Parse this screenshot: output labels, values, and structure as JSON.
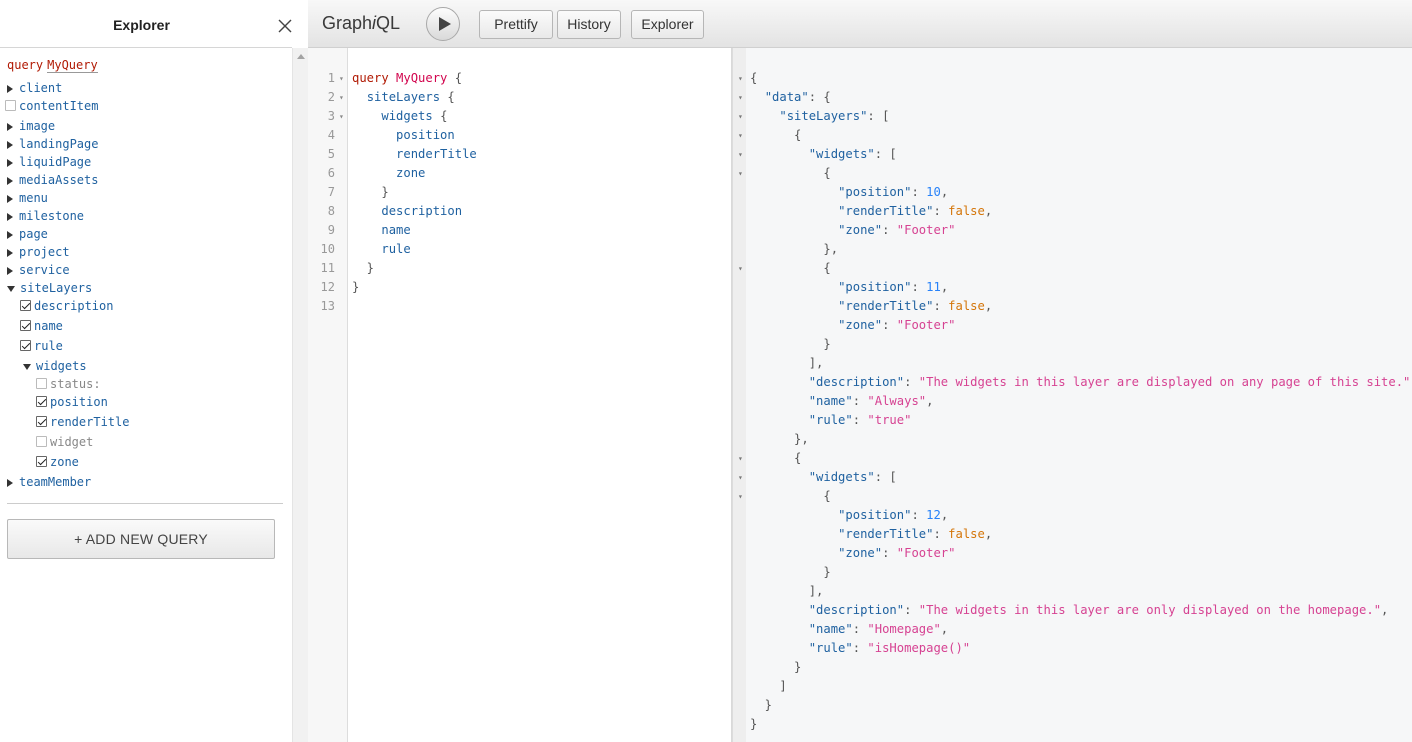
{
  "explorer": {
    "title": "Explorer",
    "query_keyword": "query",
    "query_name": "MyQuery",
    "fields": [
      {
        "name": "client",
        "state": "collapsed"
      },
      {
        "name": "contentItem",
        "state": "unchecked"
      },
      {
        "name": "image",
        "state": "collapsed"
      },
      {
        "name": "landingPage",
        "state": "collapsed"
      },
      {
        "name": "liquidPage",
        "state": "collapsed"
      },
      {
        "name": "mediaAssets",
        "state": "collapsed"
      },
      {
        "name": "menu",
        "state": "collapsed"
      },
      {
        "name": "milestone",
        "state": "collapsed"
      },
      {
        "name": "page",
        "state": "collapsed"
      },
      {
        "name": "project",
        "state": "collapsed"
      },
      {
        "name": "service",
        "state": "collapsed"
      },
      {
        "name": "siteLayers",
        "state": "expanded"
      },
      {
        "name": "teamMember",
        "state": "collapsed"
      }
    ],
    "siteLayers_children": [
      {
        "name": "description",
        "checked": true
      },
      {
        "name": "name",
        "checked": true
      },
      {
        "name": "rule",
        "checked": true
      },
      {
        "name": "widgets",
        "expanded": true
      }
    ],
    "widgets_children": [
      {
        "name": "status:",
        "checked": false
      },
      {
        "name": "position",
        "checked": true
      },
      {
        "name": "renderTitle",
        "checked": true
      },
      {
        "name": "widget",
        "checked": false
      },
      {
        "name": "zone",
        "checked": true
      }
    ],
    "add_query_label": "+ ADD NEW QUERY",
    "close_icon": "close-icon"
  },
  "toolbar": {
    "logo_prefix": "Graph",
    "logo_i": "i",
    "logo_suffix": "QL",
    "run_icon": "play-icon",
    "prettify_label": "Prettify",
    "history_label": "History",
    "explorer_label": "Explorer"
  },
  "editor": {
    "lines": [
      {
        "num": "1",
        "fold": true,
        "tokens": [
          [
            "kw",
            "query"
          ],
          [
            "pn",
            " "
          ],
          [
            "def",
            "MyQuery"
          ],
          [
            "pn",
            " {"
          ]
        ]
      },
      {
        "num": "2",
        "fold": true,
        "tokens": [
          [
            "pn",
            "  "
          ],
          [
            "prop",
            "siteLayers"
          ],
          [
            "pn",
            " {"
          ]
        ]
      },
      {
        "num": "3",
        "fold": true,
        "tokens": [
          [
            "pn",
            "    "
          ],
          [
            "prop",
            "widgets"
          ],
          [
            "pn",
            " {"
          ]
        ]
      },
      {
        "num": "4",
        "fold": false,
        "tokens": [
          [
            "pn",
            "      "
          ],
          [
            "prop",
            "position"
          ]
        ]
      },
      {
        "num": "5",
        "fold": false,
        "tokens": [
          [
            "pn",
            "      "
          ],
          [
            "prop",
            "renderTitle"
          ]
        ]
      },
      {
        "num": "6",
        "fold": false,
        "tokens": [
          [
            "pn",
            "      "
          ],
          [
            "prop",
            "zone"
          ]
        ]
      },
      {
        "num": "7",
        "fold": false,
        "tokens": [
          [
            "pn",
            "    }"
          ]
        ]
      },
      {
        "num": "8",
        "fold": false,
        "tokens": [
          [
            "pn",
            "    "
          ],
          [
            "prop",
            "description"
          ]
        ]
      },
      {
        "num": "9",
        "fold": false,
        "tokens": [
          [
            "pn",
            "    "
          ],
          [
            "prop",
            "name"
          ]
        ]
      },
      {
        "num": "10",
        "fold": false,
        "tokens": [
          [
            "pn",
            "    "
          ],
          [
            "prop",
            "rule"
          ]
        ]
      },
      {
        "num": "11",
        "fold": false,
        "tokens": [
          [
            "pn",
            "  }"
          ]
        ]
      },
      {
        "num": "12",
        "fold": false,
        "tokens": [
          [
            "pn",
            "}"
          ]
        ]
      },
      {
        "num": "13",
        "fold": false,
        "tokens": []
      }
    ]
  },
  "result": {
    "lines": [
      {
        "fold": true,
        "tokens": [
          [
            "pn",
            "{"
          ]
        ]
      },
      {
        "fold": true,
        "tokens": [
          [
            "pn",
            "  "
          ],
          [
            "rkey",
            "\"data\""
          ],
          [
            "pn",
            ": {"
          ]
        ]
      },
      {
        "fold": true,
        "tokens": [
          [
            "pn",
            "    "
          ],
          [
            "rkey",
            "\"siteLayers\""
          ],
          [
            "pn",
            ": ["
          ]
        ]
      },
      {
        "fold": true,
        "tokens": [
          [
            "pn",
            "      {"
          ]
        ]
      },
      {
        "fold": true,
        "tokens": [
          [
            "pn",
            "        "
          ],
          [
            "rkey",
            "\"widgets\""
          ],
          [
            "pn",
            ": ["
          ]
        ]
      },
      {
        "fold": true,
        "tokens": [
          [
            "pn",
            "          {"
          ]
        ]
      },
      {
        "fold": false,
        "tokens": [
          [
            "pn",
            "            "
          ],
          [
            "rkey",
            "\"position\""
          ],
          [
            "pn",
            ": "
          ],
          [
            "rnum",
            "10"
          ],
          [
            "pn",
            ","
          ]
        ]
      },
      {
        "fold": false,
        "tokens": [
          [
            "pn",
            "            "
          ],
          [
            "rkey",
            "\"renderTitle\""
          ],
          [
            "pn",
            ": "
          ],
          [
            "rbool",
            "false"
          ],
          [
            "pn",
            ","
          ]
        ]
      },
      {
        "fold": false,
        "tokens": [
          [
            "pn",
            "            "
          ],
          [
            "rkey",
            "\"zone\""
          ],
          [
            "pn",
            ": "
          ],
          [
            "rstr",
            "\"Footer\""
          ]
        ]
      },
      {
        "fold": false,
        "tokens": [
          [
            "pn",
            "          },"
          ]
        ]
      },
      {
        "fold": true,
        "tokens": [
          [
            "pn",
            "          {"
          ]
        ]
      },
      {
        "fold": false,
        "tokens": [
          [
            "pn",
            "            "
          ],
          [
            "rkey",
            "\"position\""
          ],
          [
            "pn",
            ": "
          ],
          [
            "rnum",
            "11"
          ],
          [
            "pn",
            ","
          ]
        ]
      },
      {
        "fold": false,
        "tokens": [
          [
            "pn",
            "            "
          ],
          [
            "rkey",
            "\"renderTitle\""
          ],
          [
            "pn",
            ": "
          ],
          [
            "rbool",
            "false"
          ],
          [
            "pn",
            ","
          ]
        ]
      },
      {
        "fold": false,
        "tokens": [
          [
            "pn",
            "            "
          ],
          [
            "rkey",
            "\"zone\""
          ],
          [
            "pn",
            ": "
          ],
          [
            "rstr",
            "\"Footer\""
          ]
        ]
      },
      {
        "fold": false,
        "tokens": [
          [
            "pn",
            "          }"
          ]
        ]
      },
      {
        "fold": false,
        "tokens": [
          [
            "pn",
            "        ],"
          ]
        ]
      },
      {
        "fold": false,
        "tokens": [
          [
            "pn",
            "        "
          ],
          [
            "rkey",
            "\"description\""
          ],
          [
            "pn",
            ": "
          ],
          [
            "rstr",
            "\"The widgets in this layer are displayed on any page of this site.\""
          ],
          [
            "pn",
            ","
          ]
        ]
      },
      {
        "fold": false,
        "tokens": [
          [
            "pn",
            "        "
          ],
          [
            "rkey",
            "\"name\""
          ],
          [
            "pn",
            ": "
          ],
          [
            "rstr",
            "\"Always\""
          ],
          [
            "pn",
            ","
          ]
        ]
      },
      {
        "fold": false,
        "tokens": [
          [
            "pn",
            "        "
          ],
          [
            "rkey",
            "\"rule\""
          ],
          [
            "pn",
            ": "
          ],
          [
            "rstr",
            "\"true\""
          ]
        ]
      },
      {
        "fold": false,
        "tokens": [
          [
            "pn",
            "      },"
          ]
        ]
      },
      {
        "fold": true,
        "tokens": [
          [
            "pn",
            "      {"
          ]
        ]
      },
      {
        "fold": true,
        "tokens": [
          [
            "pn",
            "        "
          ],
          [
            "rkey",
            "\"widgets\""
          ],
          [
            "pn",
            ": ["
          ]
        ]
      },
      {
        "fold": true,
        "tokens": [
          [
            "pn",
            "          {"
          ]
        ]
      },
      {
        "fold": false,
        "tokens": [
          [
            "pn",
            "            "
          ],
          [
            "rkey",
            "\"position\""
          ],
          [
            "pn",
            ": "
          ],
          [
            "rnum",
            "12"
          ],
          [
            "pn",
            ","
          ]
        ]
      },
      {
        "fold": false,
        "tokens": [
          [
            "pn",
            "            "
          ],
          [
            "rkey",
            "\"renderTitle\""
          ],
          [
            "pn",
            ": "
          ],
          [
            "rbool",
            "false"
          ],
          [
            "pn",
            ","
          ]
        ]
      },
      {
        "fold": false,
        "tokens": [
          [
            "pn",
            "            "
          ],
          [
            "rkey",
            "\"zone\""
          ],
          [
            "pn",
            ": "
          ],
          [
            "rstr",
            "\"Footer\""
          ]
        ]
      },
      {
        "fold": false,
        "tokens": [
          [
            "pn",
            "          }"
          ]
        ]
      },
      {
        "fold": false,
        "tokens": [
          [
            "pn",
            "        ],"
          ]
        ]
      },
      {
        "fold": false,
        "tokens": [
          [
            "pn",
            "        "
          ],
          [
            "rkey",
            "\"description\""
          ],
          [
            "pn",
            ": "
          ],
          [
            "rstr",
            "\"The widgets in this layer are only displayed on the homepage.\""
          ],
          [
            "pn",
            ","
          ]
        ]
      },
      {
        "fold": false,
        "tokens": [
          [
            "pn",
            "        "
          ],
          [
            "rkey",
            "\"name\""
          ],
          [
            "pn",
            ": "
          ],
          [
            "rstr",
            "\"Homepage\""
          ],
          [
            "pn",
            ","
          ]
        ]
      },
      {
        "fold": false,
        "tokens": [
          [
            "pn",
            "        "
          ],
          [
            "rkey",
            "\"rule\""
          ],
          [
            "pn",
            ": "
          ],
          [
            "rstr",
            "\"isHomepage()\""
          ]
        ]
      },
      {
        "fold": false,
        "tokens": [
          [
            "pn",
            "      }"
          ]
        ]
      },
      {
        "fold": false,
        "tokens": [
          [
            "pn",
            "    ]"
          ]
        ]
      },
      {
        "fold": false,
        "tokens": [
          [
            "pn",
            "  }"
          ]
        ]
      },
      {
        "fold": false,
        "tokens": [
          [
            "pn",
            "}"
          ]
        ]
      }
    ]
  },
  "colors": {
    "keyword": "#b11a04",
    "field": "#1f61a0",
    "string": "#d64292",
    "number": "#2882f9",
    "boolean": "#d47509"
  }
}
